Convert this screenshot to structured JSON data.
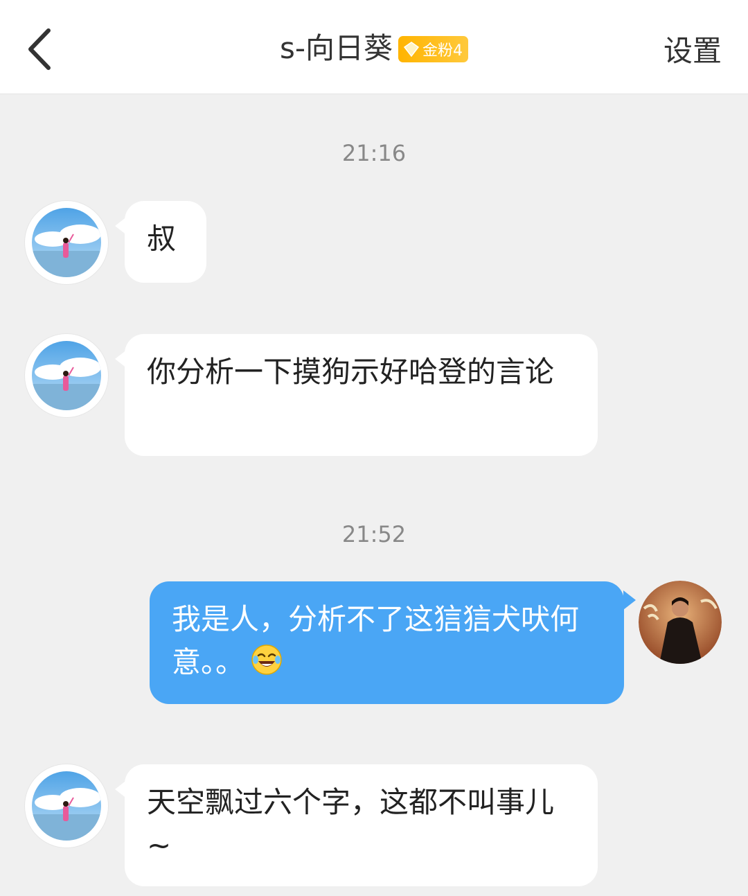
{
  "header": {
    "title": "s-向日葵",
    "fan_badge": "金粉4",
    "settings_label": "设置"
  },
  "messages": [
    {
      "time": "21:16"
    },
    {
      "side": "in",
      "text": "叔"
    },
    {
      "side": "in",
      "text": "你分析一下摸狗示好哈登的言论"
    },
    {
      "time": "21:52"
    },
    {
      "side": "out",
      "text": "我是人，分析不了这狺狺犬吠何意。。",
      "emoji": "laughing-crying"
    },
    {
      "side": "in",
      "text": "天空飘过六个字，这都不叫事儿~"
    }
  ],
  "colors": {
    "outgoing_bubble": "#4aa6f5",
    "incoming_bubble": "#ffffff",
    "background": "#f0f0f0",
    "badge": "#ffb400"
  }
}
